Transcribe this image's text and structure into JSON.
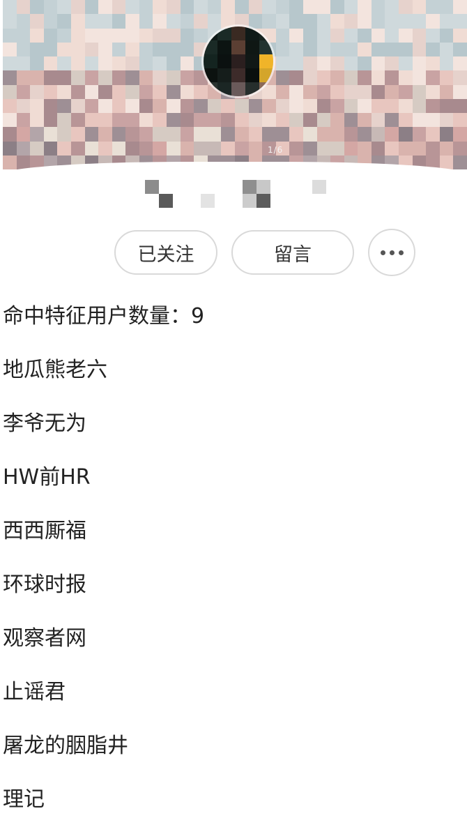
{
  "banner": {
    "page_indicator": "1/6"
  },
  "actions": {
    "follow_label": "已关注",
    "message_label": "留言"
  },
  "summary": {
    "label": "命中特征用户数量：",
    "count": "9"
  },
  "users": [
    "地瓜熊老六",
    "李爷无为",
    "HW前HR",
    "西西厮福",
    "环球时报",
    "观察者网",
    "止谣君",
    "屠龙的胭脂井",
    "理记"
  ],
  "colors": {
    "border": "#d9d9d9",
    "text": "#222222",
    "avatar_accent": "#f0b429"
  },
  "icons": {
    "more": "more-dots-icon"
  }
}
